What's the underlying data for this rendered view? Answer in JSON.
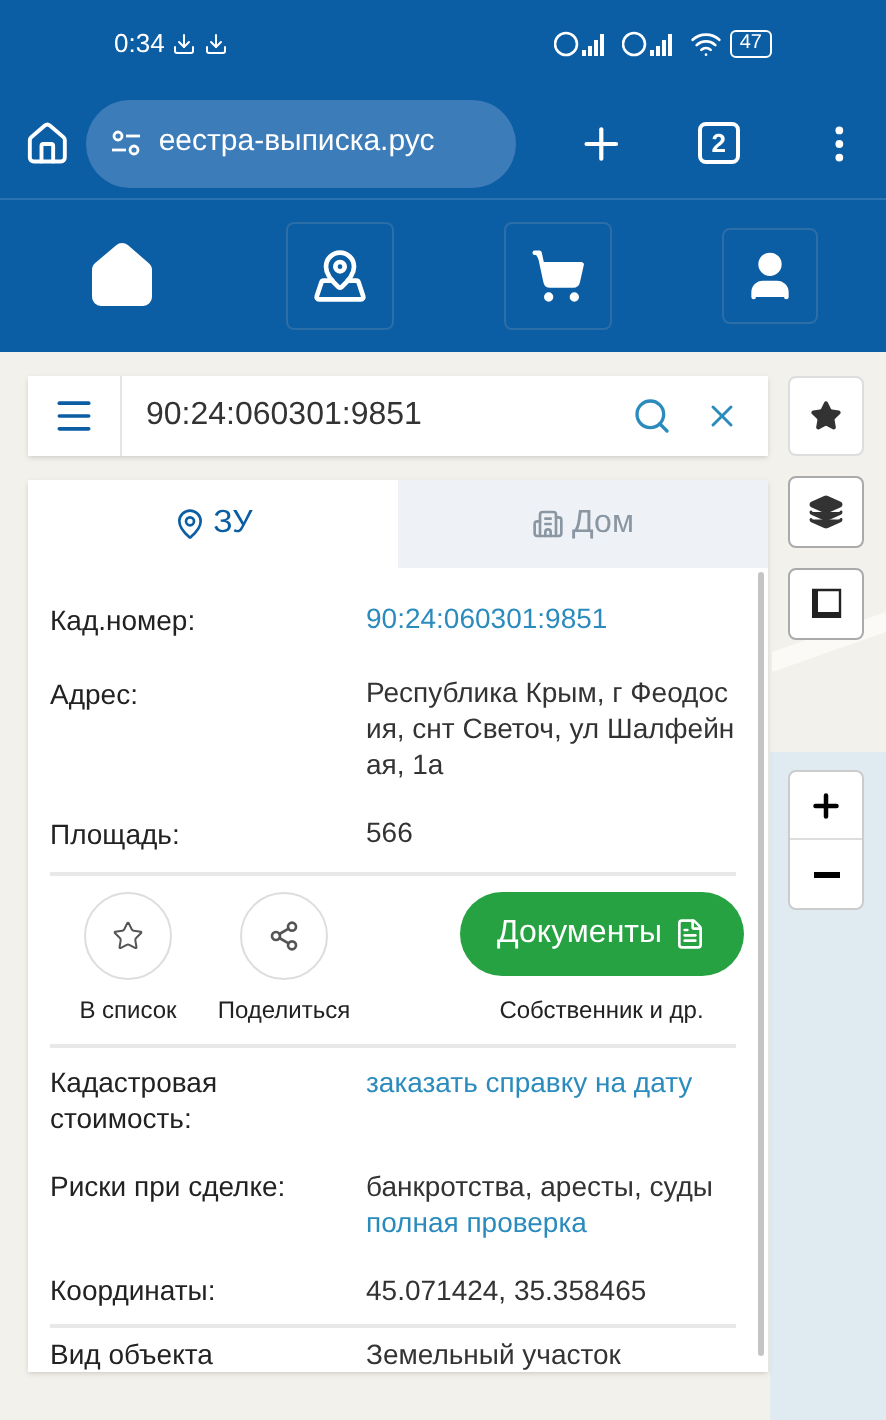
{
  "status_bar": {
    "time": "0:34",
    "battery": "47"
  },
  "browser": {
    "url": "еестра-выписка.рус",
    "tab_count": "2"
  },
  "search": {
    "value": "90:24:060301:9851"
  },
  "tabs": [
    {
      "label": "ЗУ",
      "kind": "plot",
      "selected": true
    },
    {
      "label": "Дом",
      "kind": "house",
      "selected": false
    }
  ],
  "fields": [
    {
      "label": "Кад.номер:",
      "value": "90:24:060301:9851",
      "kind": "link"
    },
    {
      "label": "Адрес:",
      "value": "Республика Крым, г Феодосия, снт Светоч, ул Шалфейная, 1а",
      "kind": "text"
    },
    {
      "label": "Площадь:",
      "value": "566",
      "kind": "text"
    }
  ],
  "actions": [
    {
      "label": "В список",
      "kind": "star"
    },
    {
      "label": "Поделиться",
      "kind": "share"
    }
  ],
  "documents_button": {
    "label": "Документы",
    "caption": "Собственник и др."
  },
  "details": [
    {
      "label": "Кадастровая стоимость:",
      "lines": [
        {
          "text": "заказать справку на дату",
          "kind": "link"
        }
      ]
    },
    {
      "label": "Риски при сделке:",
      "lines": [
        {
          "text": "банкротства, аресты, суды",
          "kind": "text"
        },
        {
          "text": "полная проверка",
          "kind": "link"
        }
      ]
    },
    {
      "label": "Координаты:",
      "lines": [
        {
          "text": "45.071424, 35.358465",
          "kind": "text"
        }
      ]
    }
  ],
  "object_type": {
    "label": "Вид объекта",
    "value": "Земельный участок"
  }
}
